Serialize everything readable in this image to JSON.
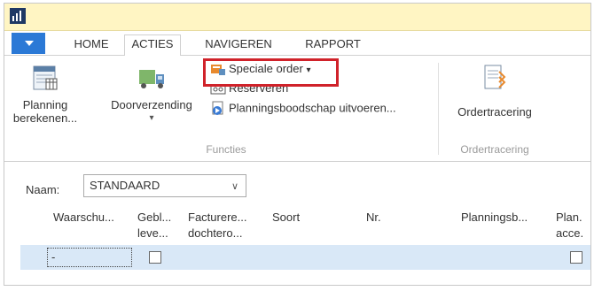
{
  "tabs": [
    {
      "label": "HOME"
    },
    {
      "label": "ACTIES"
    },
    {
      "label": "NAVIGEREN"
    },
    {
      "label": "RAPPORT"
    }
  ],
  "ribbon": {
    "planning": {
      "line1": "Planning",
      "line2": "berekenen..."
    },
    "doorverzending": {
      "label": "Doorverzending",
      "dropdown": "▾"
    },
    "speciale_order": {
      "label": "Speciale order",
      "dropdown": "▾"
    },
    "reserveren": {
      "label": "Reserveren"
    },
    "planningsboodschap": {
      "label": "Planningsboodschap uitvoeren..."
    },
    "functies_label": "Functies",
    "ordertracering": {
      "label": "Ordertracering"
    },
    "ordertracering_group": "Ordertracering"
  },
  "filter": {
    "label": "Naam:",
    "value": "STANDAARD",
    "chevron": "∨"
  },
  "grid": {
    "columns": [
      {
        "line1": "Waarschu...",
        "line2": ""
      },
      {
        "line1": "Gebl...",
        "line2": "leve..."
      },
      {
        "line1": "Facturere...",
        "line2": "dochtero..."
      },
      {
        "line1": "Soort",
        "line2": ""
      },
      {
        "line1": "Nr.",
        "line2": ""
      },
      {
        "line1": "Planningsb...",
        "line2": ""
      },
      {
        "line1": "Plan.",
        "line2": "acce."
      }
    ],
    "row": {
      "first_cell": "-",
      "checkbox1": false,
      "checkbox2": false
    }
  },
  "colors": {
    "title_bar": "#fff5c3",
    "menu_button": "#2b79d6",
    "highlight": "#d0222a",
    "selected_row": "#d9e8f7"
  }
}
